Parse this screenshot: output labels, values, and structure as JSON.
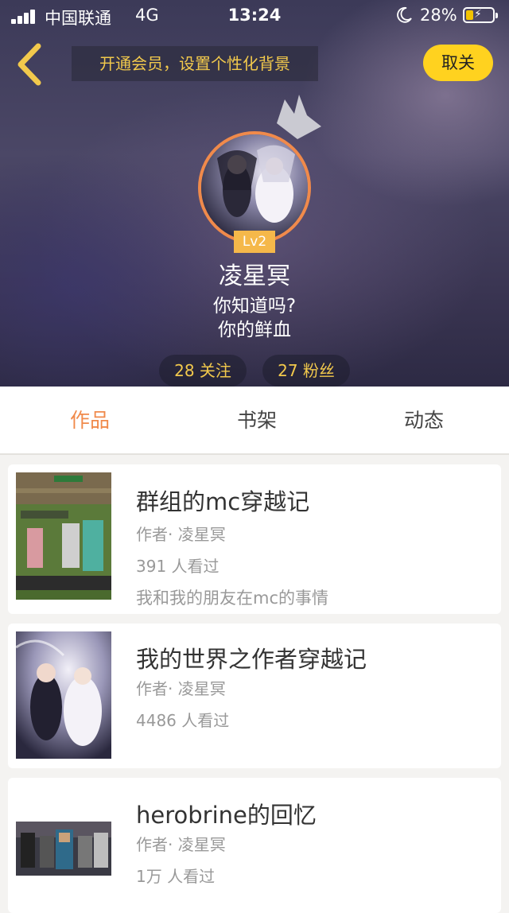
{
  "status_bar": {
    "carrier": "中国联通",
    "network": "4G",
    "time": "13:24",
    "battery_percent": "28%",
    "battery_level": 0.28
  },
  "header": {
    "promo_text": "开通会员，设置个性化背景",
    "unfollow_label": "取关",
    "level": "Lv2",
    "username": "凌星冥",
    "bio_line1": "你知道吗?",
    "bio_line2": "你的鲜血",
    "following": "28 关注",
    "followers": "27 粉丝",
    "accent_color": "#ffd21f"
  },
  "tabs": [
    {
      "label": "作品",
      "active": true
    },
    {
      "label": "书架",
      "active": false
    },
    {
      "label": "动态",
      "active": false
    }
  ],
  "works": [
    {
      "title": "群组的mc穿越记",
      "author": "作者· 凌星冥",
      "views": "391 人看过",
      "description": "我和我的朋友在mc的事情"
    },
    {
      "title": "我的世界之作者穿越记",
      "author": "作者· 凌星冥",
      "views": "4486 人看过"
    },
    {
      "title": "herobrine的回忆",
      "author": "作者· 凌星冥",
      "views": "1万 人看过"
    }
  ],
  "icons": {
    "back": "chevron-left-icon",
    "crown": "crown-icon",
    "moon": "moon-icon",
    "battery": "battery-icon",
    "signal": "signal-icon"
  }
}
